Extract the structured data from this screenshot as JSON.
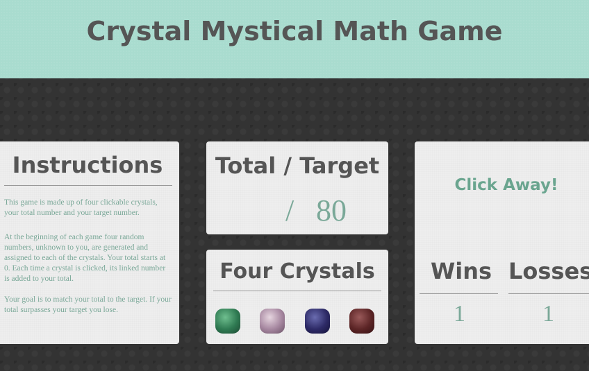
{
  "header": {
    "title": "Crystal Mystical Math Game"
  },
  "instructions": {
    "title": "Instructions",
    "paragraphs": [
      "This game is made up of four clickable crystals, your total number and your target number.",
      "At the beginning of each game four random numbers, unknown to you, are generated and assigned to each of the crystals. Your total starts at 0. Each time a crystal is clicked, its linked number is added to your total.",
      "Your goal is to match your total to the target. If your total surpasses your target you lose."
    ]
  },
  "score": {
    "title": "Total / Target",
    "user_total": "",
    "separator": "/",
    "target": "80"
  },
  "crystals": {
    "title": "Four Crystals",
    "items": [
      {
        "icon": "green-crystal-icon",
        "color": "#2f7a52"
      },
      {
        "icon": "pink-crystal-icon",
        "color": "#a687a0"
      },
      {
        "icon": "purple-crystal-icon",
        "color": "#2d2a66"
      },
      {
        "icon": "red-crystal-icon",
        "color": "#5c2526"
      }
    ]
  },
  "status": {
    "message": "Click Away!",
    "wins_label": "Wins",
    "losses_label": "Losses",
    "wins": "1",
    "losses": "1"
  },
  "colors": {
    "header_bg": "#a9dccf",
    "accent_text": "#7aa898",
    "title_text": "#555555",
    "background": "#333333"
  }
}
